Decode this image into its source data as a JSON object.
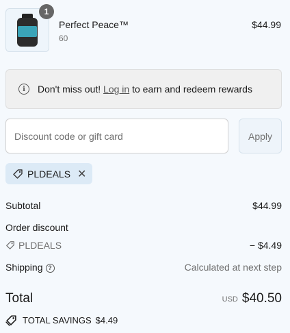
{
  "line_item": {
    "name": "Perfect Peace™",
    "variant": "60",
    "price": "$44.99",
    "quantity": "1"
  },
  "rewards_banner": {
    "prefix": "Don't miss out!",
    "link": "Log in",
    "suffix": "to earn and redeem rewards"
  },
  "discount": {
    "placeholder": "Discount code or gift card",
    "apply_label": "Apply",
    "applied_code": "PLDEALS"
  },
  "summary": {
    "subtotal_label": "Subtotal",
    "subtotal_value": "$44.99",
    "order_discount_label": "Order discount",
    "discount_code": "PLDEALS",
    "discount_value": "− $4.49",
    "shipping_label": "Shipping",
    "shipping_value": "Calculated at next step",
    "total_label": "Total",
    "currency": "USD",
    "total_value": "$40.50",
    "savings_label": "TOTAL SAVINGS",
    "savings_value": "$4.49"
  },
  "colors": {
    "page_bg": "#f5f9fd",
    "chip_bg": "#dceaf6",
    "banner_bg": "#f0f0f0"
  }
}
